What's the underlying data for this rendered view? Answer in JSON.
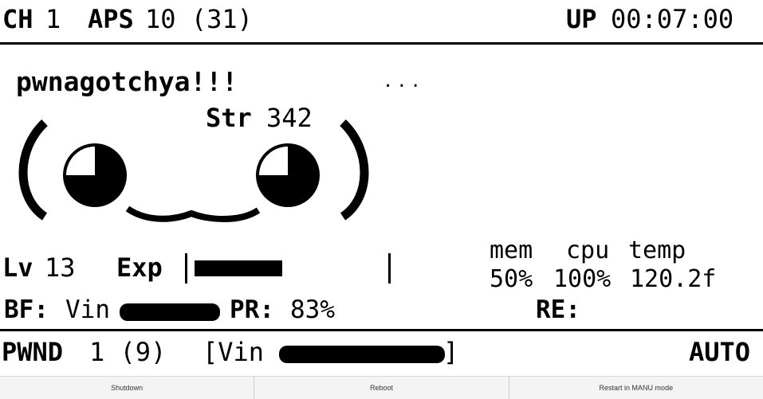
{
  "top_bar": {
    "channel_label": "CH",
    "channel_value": "1",
    "aps_label": "APS",
    "aps_value": "10 (31)",
    "uptime_label": "UP",
    "uptime_value": "00:07:00"
  },
  "face": {
    "name": "pwnagotchya!!!",
    "status": "...",
    "str_label": "Str",
    "str_value": "342"
  },
  "stats": {
    "level_label": "Lv",
    "level_value": "13",
    "exp_label": "Exp",
    "exp_progress": 0.47,
    "mem_label": "mem",
    "cpu_label": "cpu",
    "temp_label": "temp",
    "mem_value": "50%",
    "cpu_value": "100%",
    "temp_value": "120.2f"
  },
  "info_row": {
    "bf_label": "BF:",
    "bf_value": "Vin",
    "pr_label": "PR:",
    "pr_value": "83%",
    "re_label": "RE:"
  },
  "bottom_bar": {
    "pwnd_label": "PWND",
    "pwnd_value": "1 (9)",
    "last_network_open": "[Vin",
    "last_network_close": "]",
    "mode": "AUTO"
  },
  "buttons": {
    "shutdown": "Shutdown",
    "reboot": "Reboot",
    "restart": "Restart in MANU mode"
  },
  "colors": {
    "foreground": "#000000",
    "background": "#ffffff",
    "button_bg": "#f4f4f4"
  }
}
